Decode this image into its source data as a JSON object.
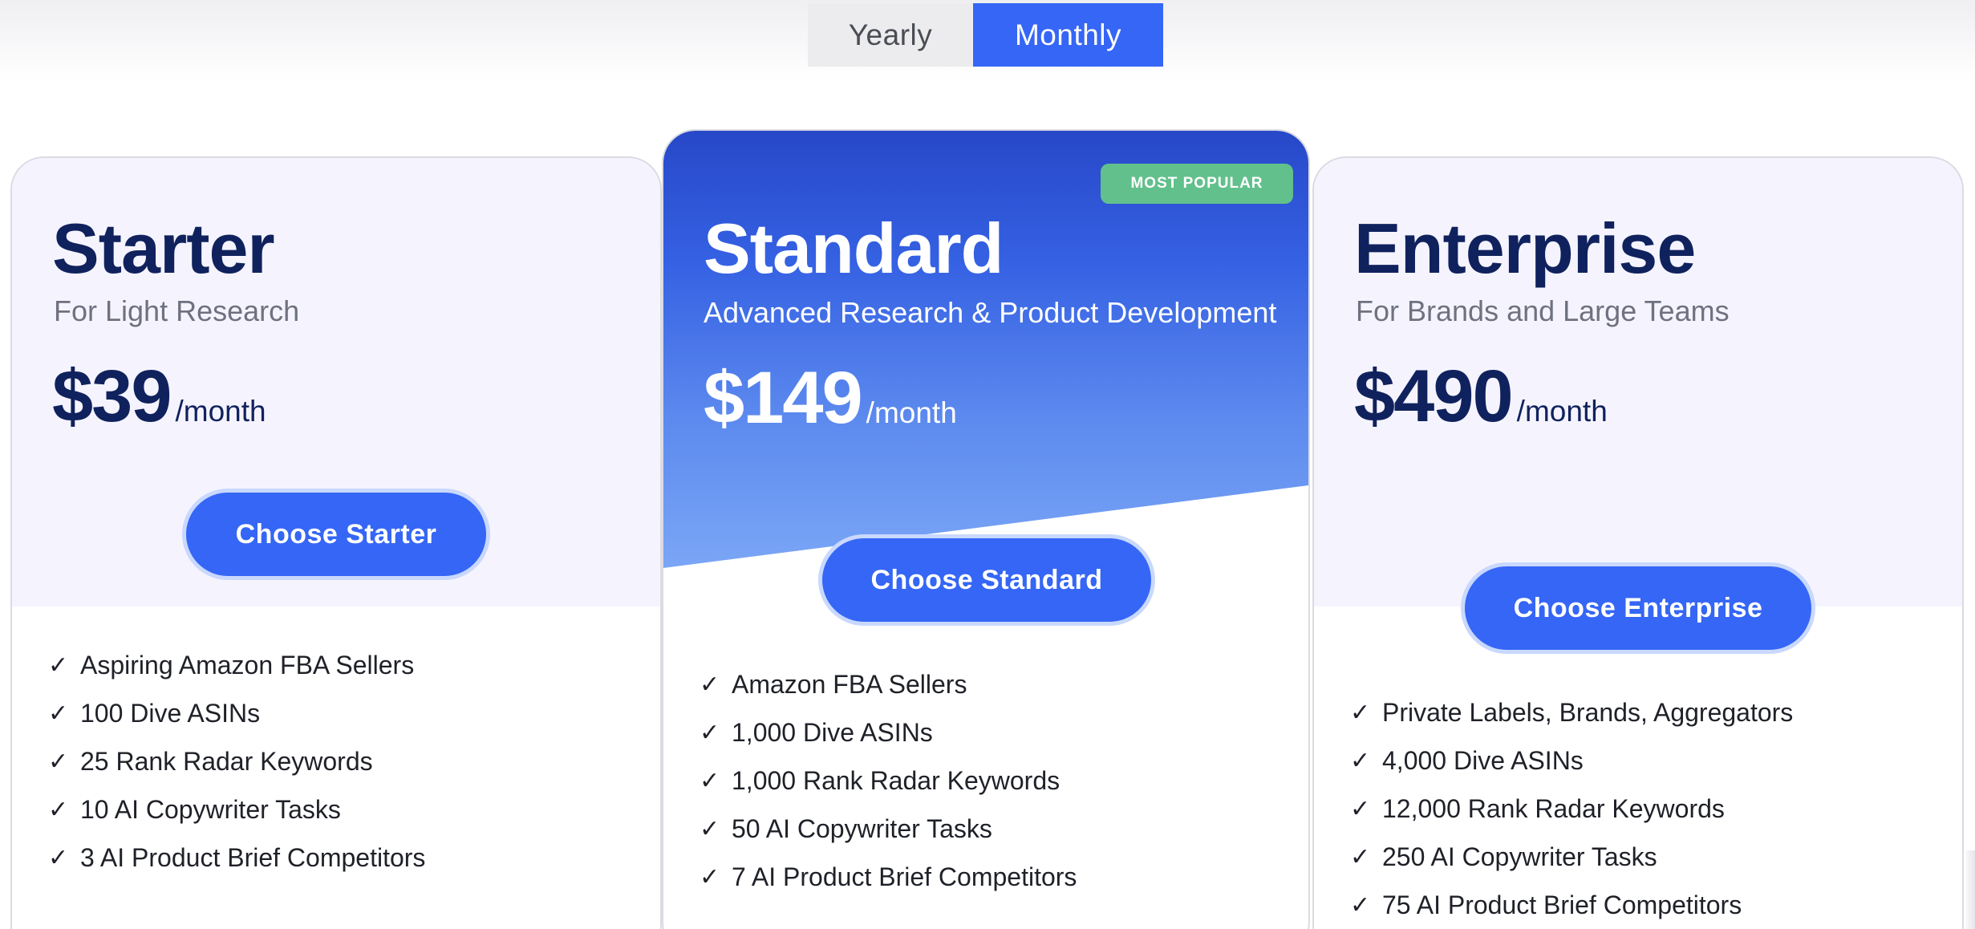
{
  "billing_toggle": {
    "options": [
      {
        "label": "Yearly",
        "selected": false
      },
      {
        "label": "Monthly",
        "selected": true
      }
    ]
  },
  "colors": {
    "accent": "#3566f5",
    "navy": "#10225d",
    "badge": "#62c08c",
    "card_tint": "#f5f4fe"
  },
  "plans": [
    {
      "name": "Starter",
      "tagline": "For Light Research",
      "price": "$39",
      "period": "/month",
      "cta": "Choose Starter",
      "features": [
        "Aspiring Amazon FBA Sellers",
        "100 Dive ASINs",
        "25 Rank Radar Keywords",
        "10 AI Copywriter Tasks",
        "3 AI Product Brief Competitors"
      ]
    },
    {
      "name": "Standard",
      "tagline": "Advanced Research & Product Development",
      "price": "$149",
      "period": "/month",
      "badge": "MOST POPULAR",
      "cta": "Choose Standard",
      "features": [
        "Amazon FBA Sellers",
        "1,000 Dive ASINs",
        "1,000 Rank Radar Keywords",
        "50 AI Copywriter Tasks",
        "7 AI Product Brief Competitors"
      ]
    },
    {
      "name": "Enterprise",
      "tagline": "For Brands and Large Teams",
      "price": "$490",
      "period": "/month",
      "cta": "Choose Enterprise",
      "features": [
        "Private Labels, Brands, Aggregators",
        "4,000 Dive ASINs",
        "12,000 Rank Radar Keywords",
        "250 AI Copywriter Tasks",
        "75 AI Product Brief Competitors"
      ]
    }
  ],
  "icons": {
    "check": "✓"
  }
}
